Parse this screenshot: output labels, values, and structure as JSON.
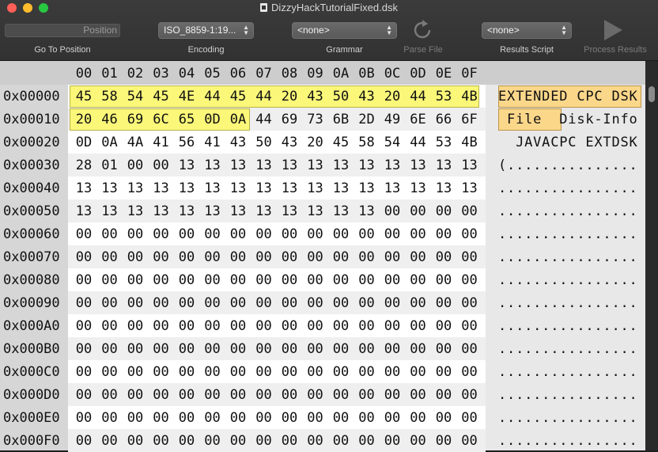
{
  "window": {
    "title": "DizzyHackTutorialFixed.dsk"
  },
  "toolbar": {
    "position_placeholder": "Position",
    "go_to_position_label": "Go To Position",
    "encoding_value": "ISO_8859-1:19...",
    "encoding_label": "Encoding",
    "grammar_value": "<none>",
    "grammar_label": "Grammar",
    "parse_file_label": "Parse File",
    "results_script_value": "<none>",
    "results_script_label": "Results Script",
    "process_results_label": "Process Results"
  },
  "hex": {
    "column_headers": [
      "00",
      "01",
      "02",
      "03",
      "04",
      "05",
      "06",
      "07",
      "08",
      "09",
      "0A",
      "0B",
      "0C",
      "0D",
      "0E",
      "0F"
    ],
    "rows": [
      {
        "offset": "0x00000",
        "bytes": [
          "45",
          "58",
          "54",
          "45",
          "4E",
          "44",
          "45",
          "44",
          "20",
          "43",
          "50",
          "43",
          "20",
          "44",
          "53",
          "4B"
        ],
        "ascii": "EXTENDED CPC DSK"
      },
      {
        "offset": "0x00010",
        "bytes": [
          "20",
          "46",
          "69",
          "6C",
          "65",
          "0D",
          "0A",
          "44",
          "69",
          "73",
          "6B",
          "2D",
          "49",
          "6E",
          "66",
          "6F"
        ],
        "ascii": " File  Disk-Info"
      },
      {
        "offset": "0x00020",
        "bytes": [
          "0D",
          "0A",
          "4A",
          "41",
          "56",
          "41",
          "43",
          "50",
          "43",
          "20",
          "45",
          "58",
          "54",
          "44",
          "53",
          "4B"
        ],
        "ascii": "  JAVACPC EXTDSK"
      },
      {
        "offset": "0x00030",
        "bytes": [
          "28",
          "01",
          "00",
          "00",
          "13",
          "13",
          "13",
          "13",
          "13",
          "13",
          "13",
          "13",
          "13",
          "13",
          "13",
          "13"
        ],
        "ascii": "(..............."
      },
      {
        "offset": "0x00040",
        "bytes": [
          "13",
          "13",
          "13",
          "13",
          "13",
          "13",
          "13",
          "13",
          "13",
          "13",
          "13",
          "13",
          "13",
          "13",
          "13",
          "13"
        ],
        "ascii": "................"
      },
      {
        "offset": "0x00050",
        "bytes": [
          "13",
          "13",
          "13",
          "13",
          "13",
          "13",
          "13",
          "13",
          "13",
          "13",
          "13",
          "13",
          "00",
          "00",
          "00",
          "00"
        ],
        "ascii": "................"
      },
      {
        "offset": "0x00060",
        "bytes": [
          "00",
          "00",
          "00",
          "00",
          "00",
          "00",
          "00",
          "00",
          "00",
          "00",
          "00",
          "00",
          "00",
          "00",
          "00",
          "00"
        ],
        "ascii": "................"
      },
      {
        "offset": "0x00070",
        "bytes": [
          "00",
          "00",
          "00",
          "00",
          "00",
          "00",
          "00",
          "00",
          "00",
          "00",
          "00",
          "00",
          "00",
          "00",
          "00",
          "00"
        ],
        "ascii": "................"
      },
      {
        "offset": "0x00080",
        "bytes": [
          "00",
          "00",
          "00",
          "00",
          "00",
          "00",
          "00",
          "00",
          "00",
          "00",
          "00",
          "00",
          "00",
          "00",
          "00",
          "00"
        ],
        "ascii": "................"
      },
      {
        "offset": "0x00090",
        "bytes": [
          "00",
          "00",
          "00",
          "00",
          "00",
          "00",
          "00",
          "00",
          "00",
          "00",
          "00",
          "00",
          "00",
          "00",
          "00",
          "00"
        ],
        "ascii": "................"
      },
      {
        "offset": "0x000A0",
        "bytes": [
          "00",
          "00",
          "00",
          "00",
          "00",
          "00",
          "00",
          "00",
          "00",
          "00",
          "00",
          "00",
          "00",
          "00",
          "00",
          "00"
        ],
        "ascii": "................"
      },
      {
        "offset": "0x000B0",
        "bytes": [
          "00",
          "00",
          "00",
          "00",
          "00",
          "00",
          "00",
          "00",
          "00",
          "00",
          "00",
          "00",
          "00",
          "00",
          "00",
          "00"
        ],
        "ascii": "................"
      },
      {
        "offset": "0x000C0",
        "bytes": [
          "00",
          "00",
          "00",
          "00",
          "00",
          "00",
          "00",
          "00",
          "00",
          "00",
          "00",
          "00",
          "00",
          "00",
          "00",
          "00"
        ],
        "ascii": "................"
      },
      {
        "offset": "0x000D0",
        "bytes": [
          "00",
          "00",
          "00",
          "00",
          "00",
          "00",
          "00",
          "00",
          "00",
          "00",
          "00",
          "00",
          "00",
          "00",
          "00",
          "00"
        ],
        "ascii": "................"
      },
      {
        "offset": "0x000E0",
        "bytes": [
          "00",
          "00",
          "00",
          "00",
          "00",
          "00",
          "00",
          "00",
          "00",
          "00",
          "00",
          "00",
          "00",
          "00",
          "00",
          "00"
        ],
        "ascii": "................"
      },
      {
        "offset": "0x000F0",
        "bytes": [
          "00",
          "00",
          "00",
          "00",
          "00",
          "00",
          "00",
          "00",
          "00",
          "00",
          "00",
          "00",
          "00",
          "00",
          "00",
          "00"
        ],
        "ascii": "................"
      }
    ],
    "selection_start": 0,
    "selection_length": 23,
    "colors": {
      "selection_hex": "#faf779",
      "selection_ascii": "#fbd78a"
    }
  }
}
